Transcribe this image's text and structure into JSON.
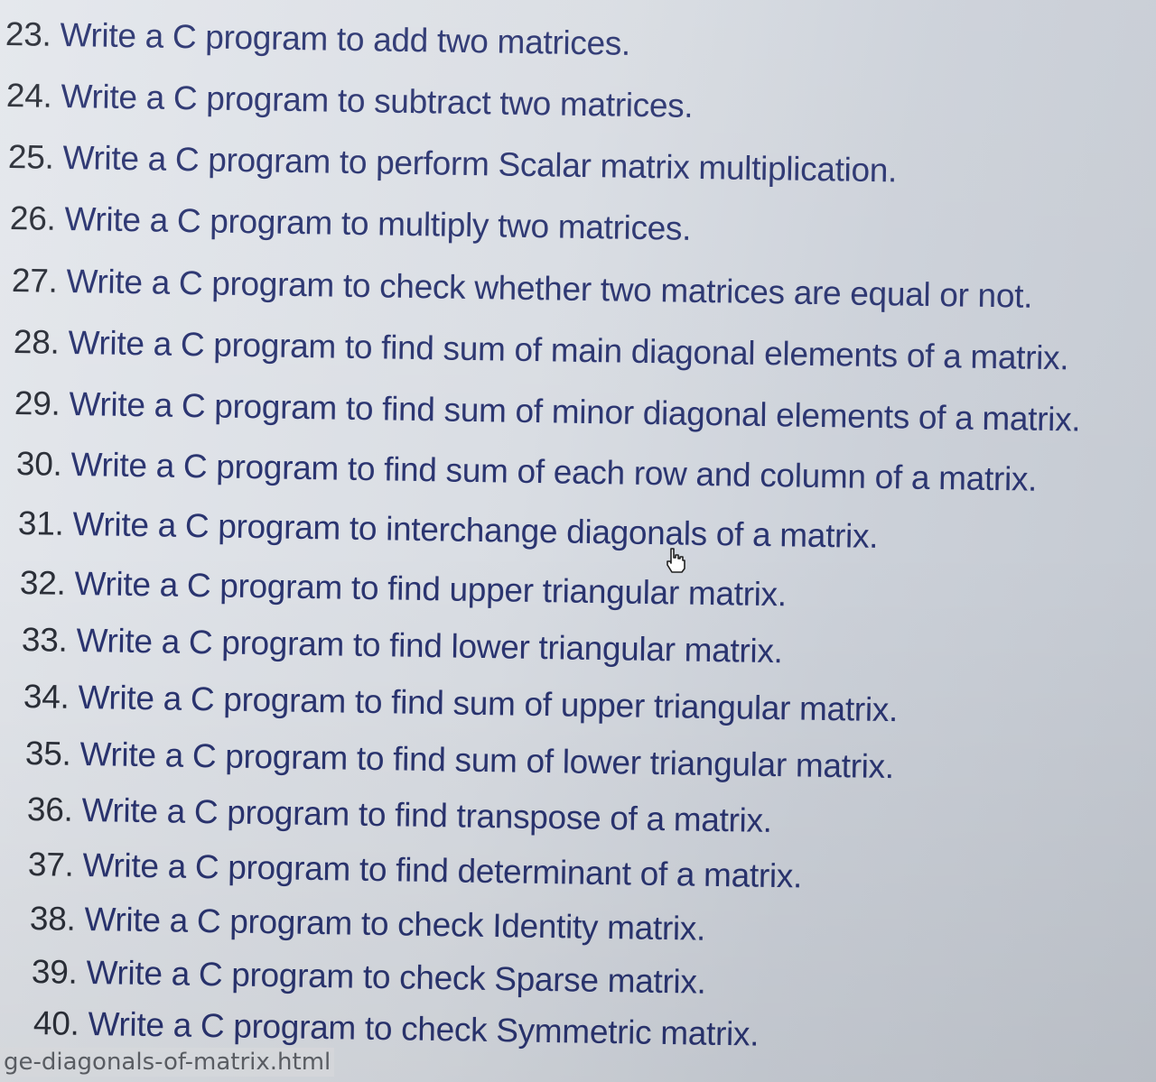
{
  "exercises": [
    {
      "num": "23.",
      "text": "Write a C program to add two matrices."
    },
    {
      "num": "24.",
      "text": "Write a C program to subtract two matrices."
    },
    {
      "num": "25.",
      "text": "Write a C program to perform Scalar matrix multiplication."
    },
    {
      "num": "26.",
      "text": "Write a C program to multiply two matrices."
    },
    {
      "num": "27.",
      "text": "Write a C program to check whether two matrices are equal or not."
    },
    {
      "num": "28.",
      "text": "Write a C program to find sum of main diagonal elements of a matrix."
    },
    {
      "num": "29.",
      "text": "Write a C program to find sum of minor diagonal elements of a matrix."
    },
    {
      "num": "30.",
      "text": "Write a C program to find sum of each row and column of a matrix."
    },
    {
      "num": "31.",
      "text": "Write a C program to interchange diagonals of a matrix."
    },
    {
      "num": "32.",
      "text": "Write a C program to find upper triangular matrix."
    },
    {
      "num": "33.",
      "text": "Write a C program to find lower triangular matrix."
    },
    {
      "num": "34.",
      "text": "Write a C program to find sum of upper triangular matrix."
    },
    {
      "num": "35.",
      "text": "Write a C program to find sum of lower triangular matrix."
    },
    {
      "num": "36.",
      "text": "Write a C program to find transpose of a matrix."
    },
    {
      "num": "37.",
      "text": "Write a C program to find determinant of a matrix."
    },
    {
      "num": "38.",
      "text": "Write a C program to check Identity matrix."
    },
    {
      "num": "39.",
      "text": "Write a C program to check Sparse matrix."
    },
    {
      "num": "40.",
      "text": "Write a C program to check Symmetric matrix."
    }
  ],
  "status_bar": {
    "url": "ge-diagonals-of-matrix.html"
  },
  "cursor": {
    "icon": "hand-pointer-icon"
  }
}
